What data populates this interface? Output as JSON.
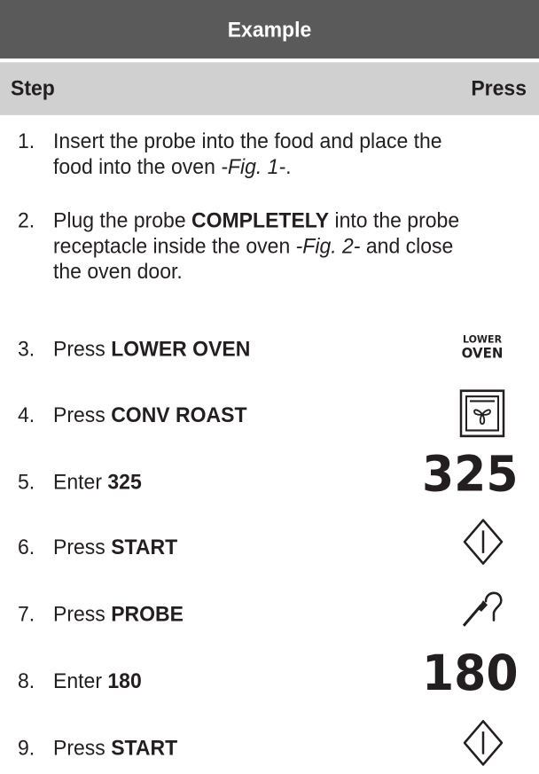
{
  "header": {
    "title": "Example"
  },
  "columns": {
    "step": "Step",
    "press": "Press"
  },
  "steps": [
    {
      "num": "1.",
      "lines": [
        "Insert the probe into the food and place the",
        "food into the oven ",
        "-Fig. 1-",
        "."
      ]
    },
    {
      "num": "2.",
      "lines": [
        "Plug the probe ",
        "COMPLETELY",
        " into the probe",
        "receptacle inside the oven ",
        "-Fig. 2-",
        " and close",
        "the oven door."
      ]
    },
    {
      "num": "3.",
      "prefix": "Press ",
      "bold": "LOWER OVEN"
    },
    {
      "num": "4.",
      "prefix": "Press ",
      "bold": "CONV ROAST"
    },
    {
      "num": "5.",
      "prefix": "Enter ",
      "bold": "325"
    },
    {
      "num": "6.",
      "prefix": "Press ",
      "bold": "START"
    },
    {
      "num": "7.",
      "prefix": "Press ",
      "bold": "PROBE"
    },
    {
      "num": "8.",
      "prefix": "Enter ",
      "bold": "180"
    },
    {
      "num": "9.",
      "prefix": "Press ",
      "bold": "START"
    }
  ],
  "press": {
    "lower_oven_line1": "LOWER",
    "lower_oven_line2": "OVEN",
    "enter_325": "325",
    "enter_180": "180",
    "icons": {
      "conv_roast": "conv-roast-fan-icon",
      "start": "start-diamond-icon",
      "probe": "probe-icon"
    }
  }
}
